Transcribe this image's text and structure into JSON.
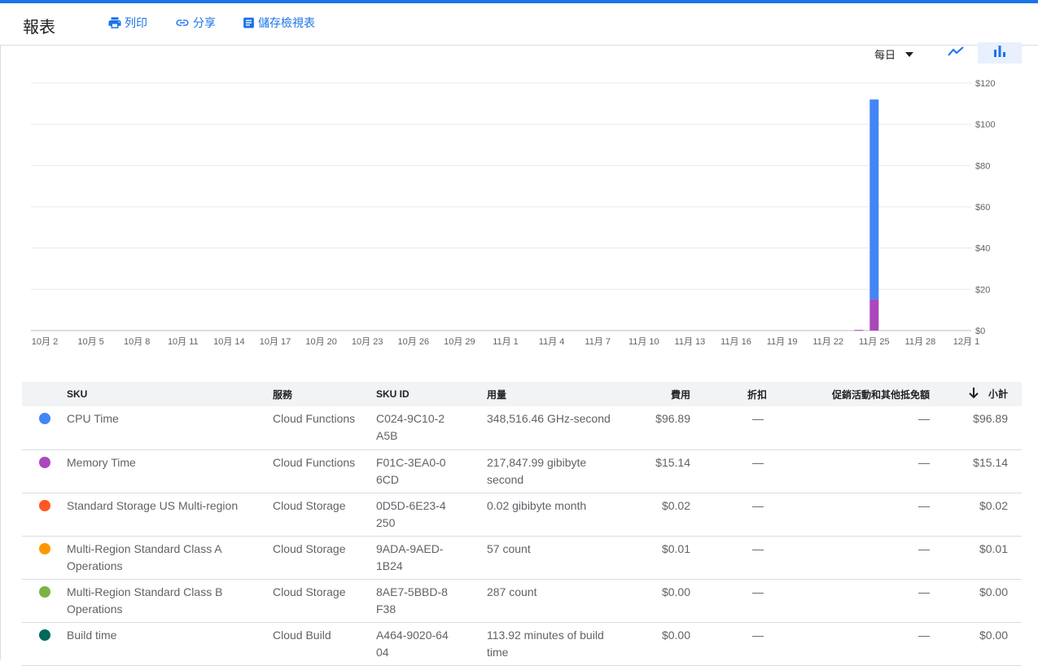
{
  "header": {
    "title": "報表",
    "print_label": "列印",
    "share_label": "分享",
    "save_view_label": "儲存檢視表"
  },
  "controls": {
    "range_label": "每日",
    "line_icon": "show-chart-icon",
    "bar_icon": "bar-chart-icon"
  },
  "colors": {
    "accent": "#1a73e8",
    "cpu": "#4285f4",
    "memory": "#ab47bc",
    "storage": "#ff5722",
    "class_a": "#ff9800",
    "class_b": "#7cb342",
    "build": "#00695c"
  },
  "chart_data": {
    "type": "bar",
    "stacked": true,
    "x_tick_labels": [
      "10月 2",
      "10月 5",
      "10月 8",
      "10月 11",
      "10月 14",
      "10月 17",
      "10月 20",
      "10月 23",
      "10月 26",
      "10月 29",
      "11月 1",
      "11月 4",
      "11月 7",
      "11月 10",
      "11月 13",
      "11月 16",
      "11月 19",
      "11月 22",
      "11月 25",
      "11月 28",
      "12月 1"
    ],
    "y_tick_labels": [
      "$0",
      "$20",
      "$40",
      "$60",
      "$80",
      "$100",
      "$120"
    ],
    "ylim": [
      0,
      120
    ],
    "grid": true,
    "x_range": [
      "10月 2",
      "12月 1"
    ],
    "series": [
      {
        "name": "CPU Time",
        "color": "#4285f4",
        "points": [
          {
            "x": "11月 25",
            "y": 96.89
          }
        ]
      },
      {
        "name": "Memory Time",
        "color": "#ab47bc",
        "points": [
          {
            "x": "11月 24",
            "y": 0.3
          },
          {
            "x": "11月 25",
            "y": 15.14
          }
        ]
      }
    ]
  },
  "table": {
    "headers": {
      "sku": "SKU",
      "service": "服務",
      "sku_id": "SKU ID",
      "usage": "用量",
      "cost": "費用",
      "discount": "折扣",
      "promo": "促銷活動和其他抵免額",
      "subtotal": "小計"
    },
    "rows": [
      {
        "color": "#4285f4",
        "sku": "CPU Time",
        "service": "Cloud Functions",
        "sku_id": "C024-9C10-2A5B",
        "usage": "348,516.46 GHz-second",
        "cost": "$96.89",
        "discount": "—",
        "promo": "—",
        "subtotal": "$96.89"
      },
      {
        "color": "#ab47bc",
        "sku": "Memory Time",
        "service": "Cloud Functions",
        "sku_id": "F01C-3EA0-06CD",
        "usage": "217,847.99 gibibyte second",
        "cost": "$15.14",
        "discount": "—",
        "promo": "—",
        "subtotal": "$15.14"
      },
      {
        "color": "#ff5722",
        "sku": "Standard Storage US Multi-region",
        "service": "Cloud Storage",
        "sku_id": "0D5D-6E23-4250",
        "usage": "0.02 gibibyte month",
        "cost": "$0.02",
        "discount": "—",
        "promo": "—",
        "subtotal": "$0.02"
      },
      {
        "color": "#ff9800",
        "sku": "Multi-Region Standard Class A Operations",
        "service": "Cloud Storage",
        "sku_id": "9ADA-9AED-1B24",
        "usage": "57 count",
        "cost": "$0.01",
        "discount": "—",
        "promo": "—",
        "subtotal": "$0.01"
      },
      {
        "color": "#7cb342",
        "sku": "Multi-Region Standard Class B Operations",
        "service": "Cloud Storage",
        "sku_id": "8AE7-5BBD-8F38",
        "usage": "287 count",
        "cost": "$0.00",
        "discount": "—",
        "promo": "—",
        "subtotal": "$0.00"
      },
      {
        "color": "#00695c",
        "sku": "Build time",
        "service": "Cloud Build",
        "sku_id": "A464-9020-6404",
        "usage": "113.92 minutes of build time",
        "cost": "$0.00",
        "discount": "—",
        "promo": "—",
        "subtotal": "$0.00"
      }
    ]
  }
}
